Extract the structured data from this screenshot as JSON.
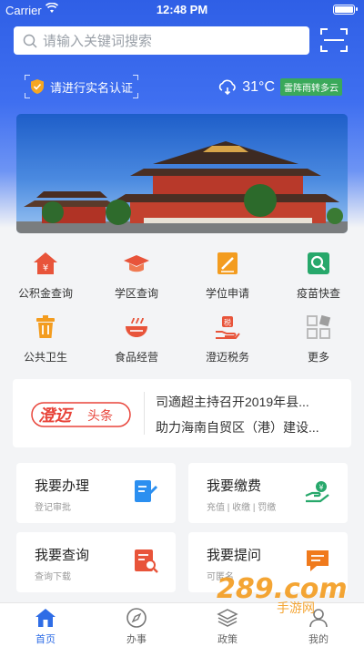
{
  "status": {
    "carrier": "Carrier",
    "time": "12:48 PM"
  },
  "search": {
    "placeholder": "请输入关键词搜索"
  },
  "realname": {
    "label": "请进行实名认证"
  },
  "weather": {
    "temp": "31°C",
    "condition": "雷阵雨转多云"
  },
  "services": [
    {
      "label": "公积金查询",
      "icon": "house-fund-icon"
    },
    {
      "label": "学区查询",
      "icon": "graduation-cap-icon"
    },
    {
      "label": "学位申请",
      "icon": "pen-document-icon"
    },
    {
      "label": "疫苗快查",
      "icon": "search-icon"
    },
    {
      "label": "公共卫生",
      "icon": "trash-can-icon"
    },
    {
      "label": "食品经营",
      "icon": "food-bowl-icon"
    },
    {
      "label": "澄迈税务",
      "icon": "tax-hand-icon"
    },
    {
      "label": "更多",
      "icon": "grid-more-icon"
    }
  ],
  "news": {
    "logo_main": "澄迈",
    "logo_tag": "头条",
    "headlines": [
      "司適超主持召开2019年县...",
      "助力海南自贸区（港）建设..."
    ]
  },
  "cards": [
    {
      "title": "我要办理",
      "sub": "登记审批",
      "icon": "form-pen-icon"
    },
    {
      "title": "我要缴费",
      "sub": "充值 | 收缴 | 罚缴",
      "icon": "hand-coin-icon"
    },
    {
      "title": "我要查询",
      "sub": "查询下载",
      "icon": "doc-search-icon"
    },
    {
      "title": "我要提问",
      "sub": "可匿名",
      "icon": "chat-bubble-icon"
    }
  ],
  "tabs": [
    {
      "label": "首页",
      "icon": "home-icon",
      "active": true
    },
    {
      "label": "办事",
      "icon": "compass-icon",
      "active": false
    },
    {
      "label": "政策",
      "icon": "layers-icon",
      "active": false
    },
    {
      "label": "我的",
      "icon": "user-icon",
      "active": false
    }
  ],
  "watermark": {
    "brand": "289.com",
    "sub": "手游网"
  },
  "colors": {
    "accent": "#2f6de6",
    "icon_red": "#e8543a",
    "icon_orange": "#f39c1f",
    "icon_green": "#27a86b",
    "icon_blue": "#2b8ff0"
  }
}
